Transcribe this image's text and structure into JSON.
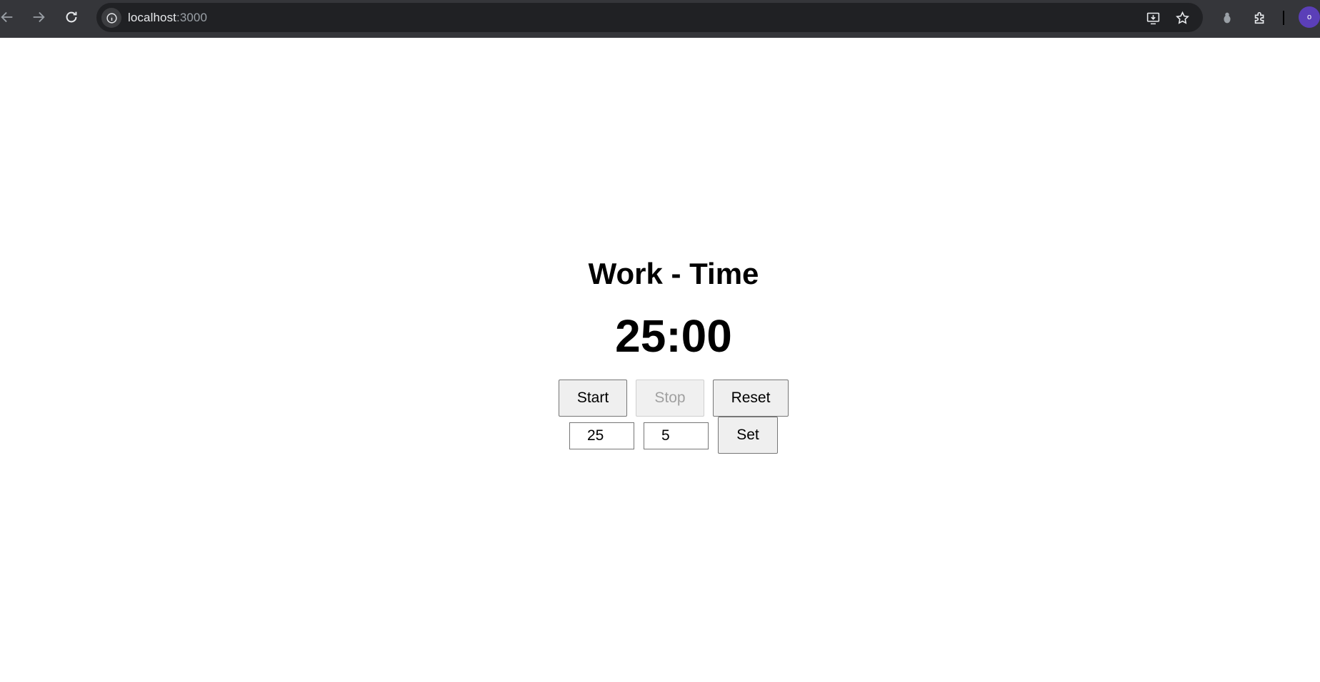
{
  "browser": {
    "url_host": "localhost",
    "url_port": ":3000",
    "profile_initial": "o",
    "icons": [
      "back-icon",
      "forward-icon",
      "reload-icon",
      "site-info-icon",
      "install-app-icon",
      "bookmark-star-icon",
      "extension-puzzle-icon",
      "profile-avatar"
    ]
  },
  "timer": {
    "mode_title": "Work - Time",
    "display": "25:00"
  },
  "controls": {
    "start_label": "Start",
    "stop_label": "Stop",
    "reset_label": "Reset",
    "set_label": "Set",
    "work_minutes": "25",
    "break_minutes": "5"
  }
}
